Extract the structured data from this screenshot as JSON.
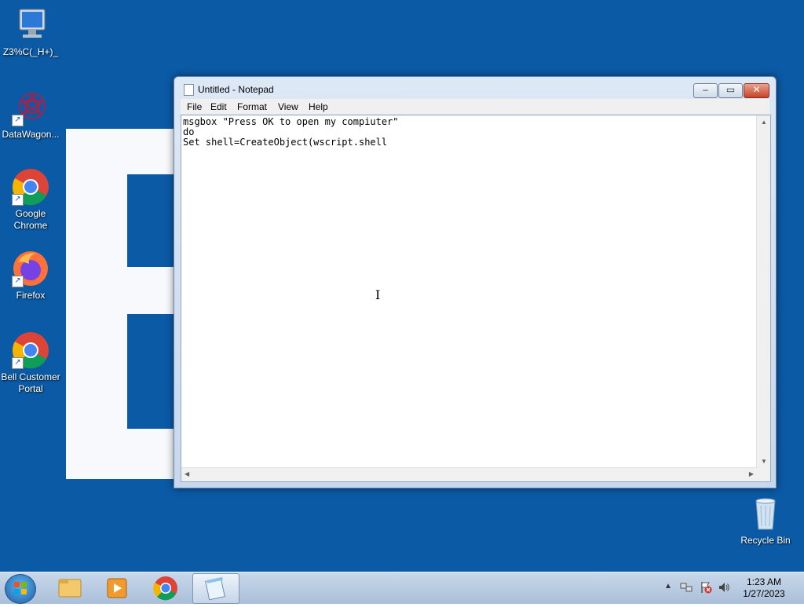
{
  "desktop": {
    "icons": [
      {
        "label": "Z3%C(_H+)_",
        "icon": "computer-icon"
      },
      {
        "label": "DataWagon...",
        "icon": "datawagon-icon"
      },
      {
        "label": "Google Chrome",
        "icon": "chrome-icon"
      },
      {
        "label": "Firefox",
        "icon": "firefox-icon"
      },
      {
        "label": "Bell Customer Portal",
        "icon": "chrome-icon"
      },
      {
        "label": "Recycle Bin",
        "icon": "recycle-bin-icon"
      }
    ]
  },
  "notepad": {
    "title": "Untitled - Notepad",
    "menu": [
      "File",
      "Edit",
      "Format",
      "View",
      "Help"
    ],
    "content": "msgbox \"Press OK to open my compiuter\"\ndo\nSet shell=CreateObject(wscript.shell",
    "buttons": {
      "minimize": "minimize-icon",
      "maximize": "maximize-icon",
      "close": "close-icon"
    }
  },
  "taskbar": {
    "pinned": [
      "file-explorer-icon",
      "media-player-icon",
      "chrome-icon",
      "notepad-icon"
    ],
    "active": "notepad-icon",
    "clock": {
      "time": "1:23 AM",
      "date": "1/27/2023"
    }
  },
  "colors": {
    "desktop": "#0b5aa6",
    "taskbar": "#b9cde3",
    "close_button": "#c7432a"
  }
}
